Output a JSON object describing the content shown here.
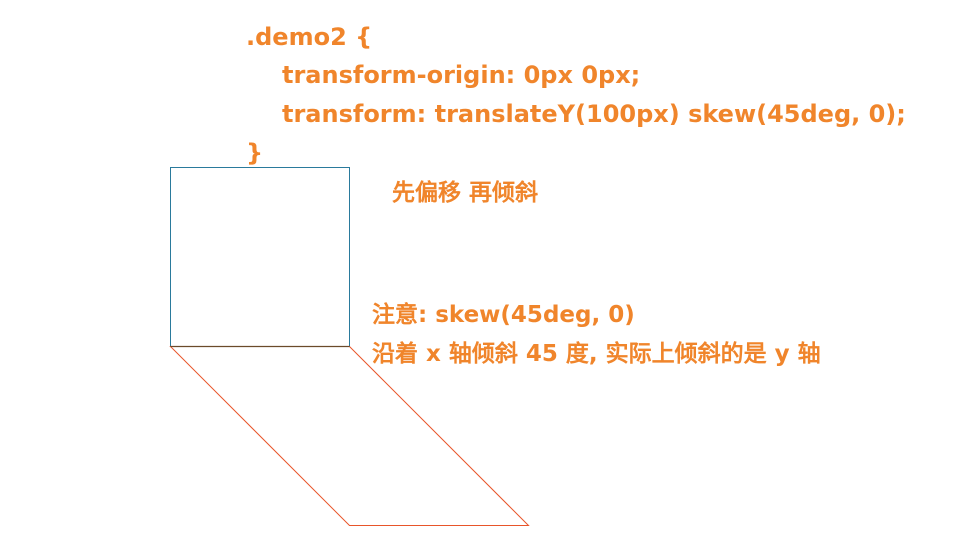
{
  "code": {
    "line1": ".demo2 {",
    "line2": "transform-origin: 0px 0px;",
    "line3": "transform: translateY(100px) skew(45deg, 0);",
    "line4": "}"
  },
  "notes": {
    "order": "先偏移 再倾斜",
    "attention": "注意: skew(45deg, 0)",
    "explanation": "沿着 x 轴倾斜 45 度, 实际上倾斜的是 y 轴"
  },
  "colors": {
    "text": "#f0852b",
    "original_box": "#2a7a9c",
    "skewed_box": "#e8552a"
  }
}
